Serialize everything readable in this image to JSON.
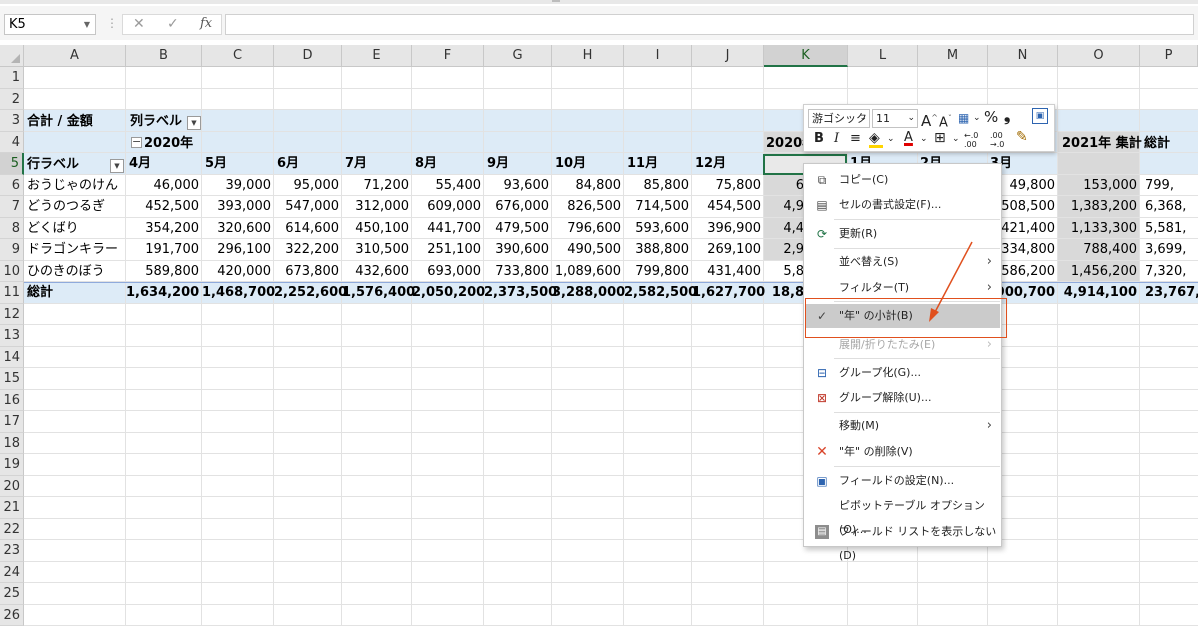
{
  "formula_bar": {
    "name_box": "K5",
    "cancel_icon": "✕",
    "enter_icon": "✓",
    "fx_label": "fx",
    "formula": ""
  },
  "columns": [
    "A",
    "B",
    "C",
    "D",
    "E",
    "F",
    "G",
    "H",
    "I",
    "J",
    "K",
    "L",
    "M",
    "N",
    "O",
    "P"
  ],
  "selected_column": "K",
  "rows": [
    "1",
    "2",
    "3",
    "4",
    "5",
    "6",
    "7",
    "8",
    "9",
    "10",
    "11",
    "12",
    "13",
    "14",
    "15",
    "16",
    "17",
    "18",
    "19",
    "20",
    "21",
    "22",
    "23",
    "24",
    "25",
    "26"
  ],
  "selected_row": "5",
  "pivot": {
    "value_label": "合計 / 金額",
    "col_label": "列ラベル",
    "year_2020": "2020年",
    "row_label": "行ラベル",
    "months": [
      "4月",
      "5月",
      "6月",
      "7月",
      "8月",
      "9月",
      "10月",
      "11月",
      "12月"
    ],
    "year_2020_subtotal_header": "2020年",
    "months_2021": [
      "1月",
      "2月",
      "3月"
    ],
    "year_2021_total_header": "2021年 集計",
    "grand_total_header": "総計",
    "items": [
      {
        "name": "おうじゃのけん",
        "values": [
          "46,000",
          "39,000",
          "95,000",
          "71,200",
          "55,400",
          "93,600",
          "84,800",
          "85,800",
          "75,800"
        ],
        "k": "6",
        "n": "49,800",
        "o": "153,000",
        "p": "799,"
      },
      {
        "name": "どうのつるぎ",
        "values": [
          "452,500",
          "393,000",
          "547,000",
          "312,000",
          "609,000",
          "676,000",
          "826,500",
          "714,500",
          "454,500"
        ],
        "k": "4,9",
        "n": "508,500",
        "o": "1,383,200",
        "p": "6,368,"
      },
      {
        "name": "どくばり",
        "values": [
          "354,200",
          "320,600",
          "614,600",
          "450,100",
          "441,700",
          "479,500",
          "796,600",
          "593,600",
          "396,900"
        ],
        "k": "4,4",
        "n": "421,400",
        "o": "1,133,300",
        "p": "5,581,"
      },
      {
        "name": "ドラゴンキラー",
        "values": [
          "191,700",
          "296,100",
          "322,200",
          "310,500",
          "251,100",
          "390,600",
          "490,500",
          "388,800",
          "269,100"
        ],
        "k": "2,9",
        "n": "334,800",
        "o": "788,400",
        "p": "3,699,"
      },
      {
        "name": "ひのきのぼう",
        "values": [
          "589,800",
          "420,000",
          "673,800",
          "432,600",
          "693,000",
          "733,800",
          "1,089,600",
          "799,800",
          "431,400"
        ],
        "k": "5,8",
        "n": "586,200",
        "o": "1,456,200",
        "p": "7,320,"
      }
    ],
    "total": {
      "name": "総計",
      "values": [
        "1,634,200",
        "1,468,700",
        "2,252,600",
        "1,576,400",
        "2,050,200",
        "2,373,500",
        "3,288,000",
        "2,582,500",
        "1,627,700"
      ],
      "k": "18,8",
      "n": "900,700",
      "o": "4,914,100",
      "p": "23,767,9"
    }
  },
  "mini_toolbar": {
    "font_name": "游ゴシック",
    "font_size": "11",
    "grow_font": "A",
    "shrink_font": "A",
    "percent": "%",
    "comma": "❟",
    "bold": "B",
    "italic": "I",
    "align": "≡",
    "font_color_letter": "A",
    "dec_increase": "←.0 .00",
    "dec_decrease": ".00 →.0"
  },
  "context_menu": {
    "items": [
      {
        "label": "コピー(C)",
        "icon": "copy-icon"
      },
      {
        "label": "セルの書式設定(F)...",
        "icon": "format-cells-icon"
      },
      {
        "label": "更新(R)",
        "icon": "refresh-icon"
      },
      {
        "label": "並べ替え(S)"
      },
      {
        "label": "フィルター(T)"
      },
      {
        "label": "\"年\" の小計(B)",
        "checked": "✓"
      },
      {
        "label": "展開/折りたたみ(E)"
      },
      {
        "label": "グループ化(G)...",
        "icon": "group-icon"
      },
      {
        "label": "グループ解除(U)...",
        "icon": "ungroup-icon"
      },
      {
        "label": "移動(M)"
      },
      {
        "label": "\"年\" の削除(V)",
        "icon": "delete-x-icon"
      },
      {
        "label": "フィールドの設定(N)...",
        "icon": "field-settings-icon"
      },
      {
        "label": "ピボットテーブル オプション(O)..."
      },
      {
        "label": "フィールド リストを表示しない(D)",
        "icon": "field-list-icon"
      }
    ],
    "submenu_arrow": "›"
  },
  "colors": {
    "accent": "#217346",
    "pivot_band": "#ddebf7",
    "subtotal_gray": "#d9d9d9",
    "annotation": "#e0501e"
  }
}
